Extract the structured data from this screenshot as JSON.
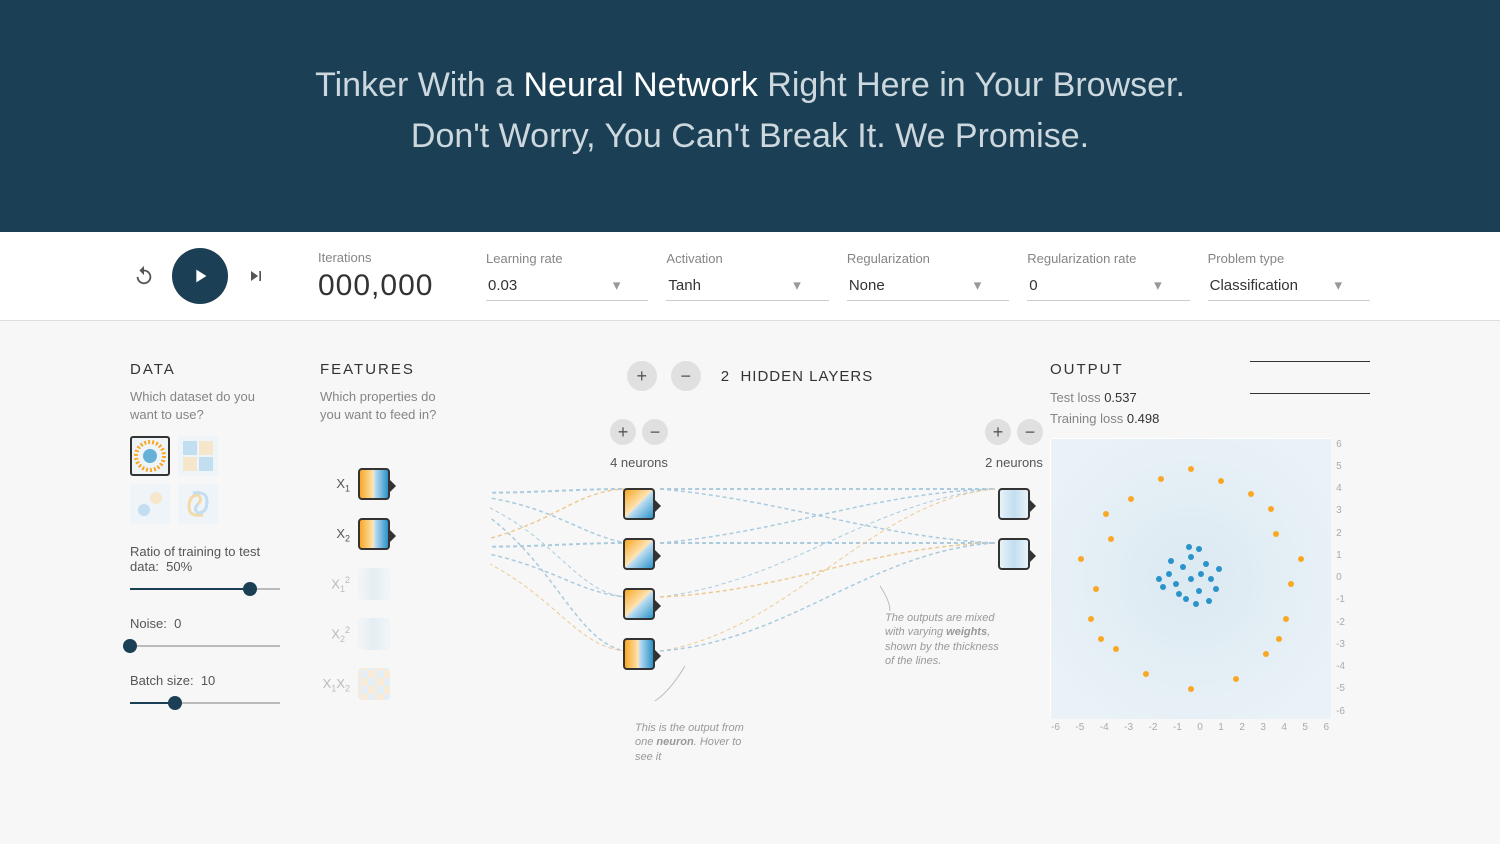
{
  "hero": {
    "line1_prefix": "Tinker With a ",
    "line1_strong": "Neural Network",
    "line1_suffix": " Right Here in Your Browser.",
    "line2": "Don't Worry, You Can't Break It. We Promise."
  },
  "controls": {
    "iterations_label": "Iterations",
    "iterations_value": "000,000",
    "learning_rate_label": "Learning rate",
    "learning_rate_value": "0.03",
    "activation_label": "Activation",
    "activation_value": "Tanh",
    "regularization_label": "Regularization",
    "regularization_value": "None",
    "reg_rate_label": "Regularization rate",
    "reg_rate_value": "0",
    "problem_label": "Problem type",
    "problem_value": "Classification"
  },
  "data": {
    "heading": "DATA",
    "subtext": "Which dataset do you want to use?",
    "datasets": [
      "circle",
      "xor",
      "gauss",
      "spiral"
    ],
    "selected_index": 0,
    "ratio_label": "Ratio of training to test data:",
    "ratio_value": "50%",
    "ratio_pct": 80,
    "noise_label": "Noise:",
    "noise_value": "0",
    "noise_pct": 0,
    "batch_label": "Batch size:",
    "batch_value": "10",
    "batch_pct": 30
  },
  "features": {
    "heading": "FEATURES",
    "subtext": "Which properties do you want to feed in?",
    "items": [
      {
        "label": "X<sub>1</sub>",
        "active": true,
        "style": ""
      },
      {
        "label": "X<sub>2</sub>",
        "active": true,
        "style": ""
      },
      {
        "label": "X<sub>1</sub><sup>2</sup>",
        "active": false,
        "style": "soft"
      },
      {
        "label": "X<sub>2</sub><sup>2</sup>",
        "active": false,
        "style": "soft"
      },
      {
        "label": "X<sub>1</sub>X<sub>2</sub>",
        "active": false,
        "style": "checker"
      }
    ]
  },
  "network": {
    "hidden_layers_count": "2",
    "hidden_layers_label": "HIDDEN LAYERS",
    "layers": [
      {
        "neurons": "4 neurons",
        "count": 4
      },
      {
        "neurons": "2 neurons",
        "count": 2
      }
    ],
    "callout_weights": "The outputs are mixed with varying <b>weights</b>, shown by the thickness of the lines.",
    "callout_neuron": "This is the output from one <b>neuron</b>. Hover to see it"
  },
  "output": {
    "heading": "OUTPUT",
    "test_loss_label": "Test loss",
    "test_loss_value": "0.537",
    "training_loss_label": "Training loss",
    "training_loss_value": "0.498",
    "axis_ticks": [
      "-6",
      "-5",
      "-4",
      "-3",
      "-2",
      "-1",
      "0",
      "1",
      "2",
      "3",
      "4",
      "5",
      "6"
    ]
  }
}
